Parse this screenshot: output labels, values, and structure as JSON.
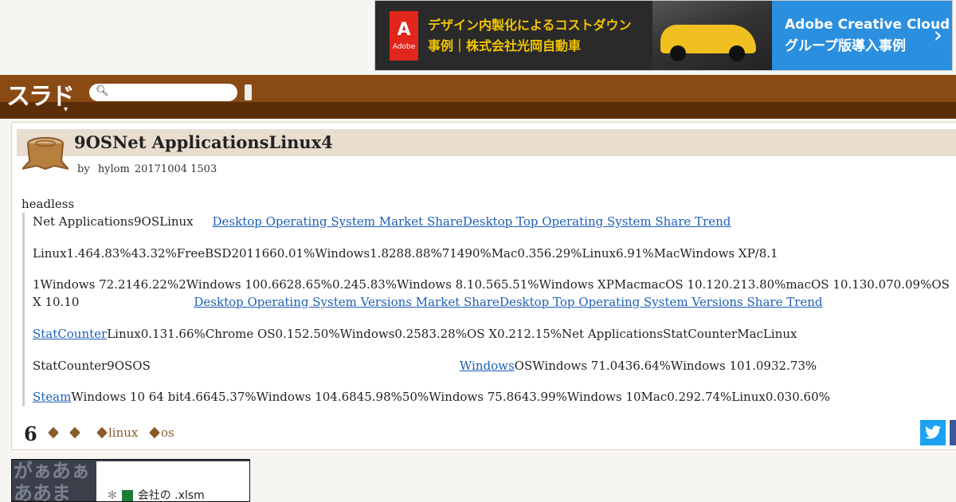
{
  "colors": {
    "topbar": "#8a4a14",
    "subbar": "#5c2e08",
    "link": "#1e5fb3",
    "title_bg": "#e8ddcf"
  },
  "banner_ad": {
    "logo_word": "Adobe",
    "line1": "デザイン内製化によるコストダウン",
    "line2": "事例｜株式会社光岡自動車",
    "right_line1": "Adobe Creative Cloud",
    "right_line2": "グループ版導入事例",
    "chevron": "›"
  },
  "header": {
    "logo": "スラド",
    "search_icon": "search-icon",
    "menu_caret": "▾"
  },
  "article": {
    "title": "9OSNet ApplicationsLinux4",
    "by": "by",
    "author": "hylom",
    "date": "20171004 1503",
    "lead": "headless",
    "p1_text": "Net Applications9OSLinux",
    "p1_link": "Desktop Operating System Market ShareDesktop Top Operating System Share Trend",
    "p2_text": "Linux1.464.83%43.32%FreeBSD2011660.01%Windows1.8288.88%71490%Mac0.356.29%Linux6.91%MacWindows XP/8.1",
    "p3_line1": "1Windows 72.2146.22%2Windows 100.6628.65%0.245.83%Windows 8.10.565.51%Windows XPMacmacOS 10.120.213.80%macOS 10.130.070.09%OS",
    "p3_line2": "X 10.10",
    "p3_link": "Desktop Operating System Versions Market ShareDesktop Top Operating System Versions Share Trend",
    "p4_link": "StatCounter",
    "p4_text": "Linux0.131.66%Chrome OS0.152.50%Windows0.2583.28%OS X0.212.15%Net ApplicationsStatCounterMacLinux",
    "p5_text": "StatCounter9OSOS",
    "p5_link": "Windows",
    "p5_text2": "OSWindows 71.0436.64%Windows 101.0932.73%",
    "p6_link": "Steam",
    "p6_text": "Windows 10 64 bit4.6645.37%Windows 104.6845.98%50%Windows 75.8643.99%Windows 10Mac0.292.74%Linux0.030.60%"
  },
  "footer": {
    "comment_count": "6",
    "tags": [
      "",
      "",
      "linux",
      "os"
    ],
    "twitter_icon": "twitter-icon"
  },
  "bottom_ad": {
    "bg_line1": "がぁあぁ",
    "bg_line2": "ああま",
    "close": "✕",
    "file_label": "会社の .xlsm"
  }
}
